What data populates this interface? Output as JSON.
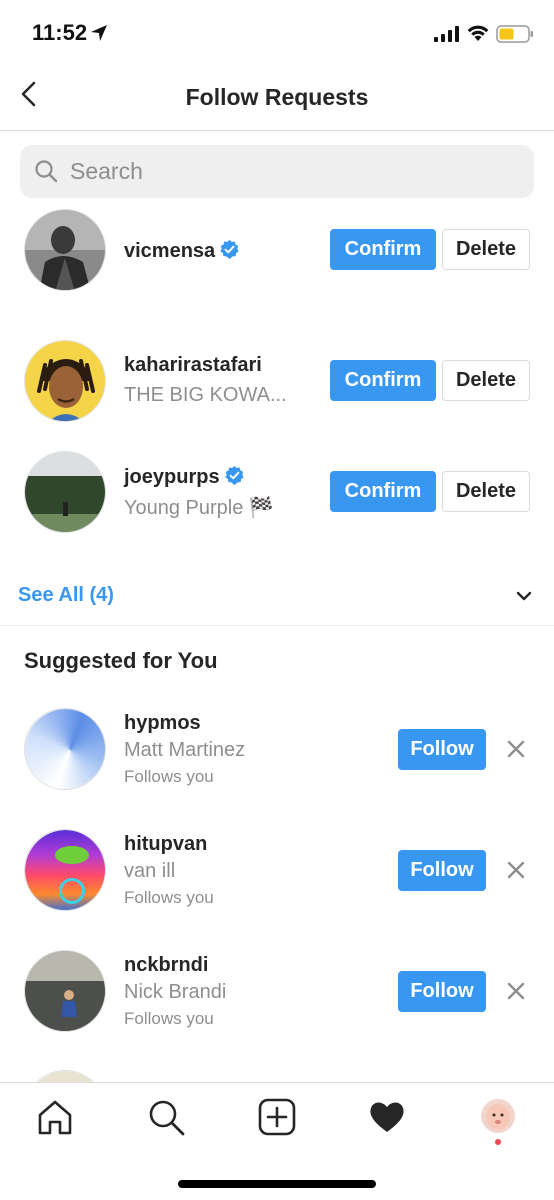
{
  "status_bar": {
    "time": "11:52"
  },
  "header": {
    "title": "Follow Requests"
  },
  "search": {
    "placeholder": "Search"
  },
  "follow_requests": [
    {
      "username": "vicmensa",
      "verified": true,
      "subtitle": "",
      "confirm_label": "Confirm",
      "delete_label": "Delete"
    },
    {
      "username": "kaharirastafari",
      "verified": false,
      "subtitle": "THE BIG KOWA...",
      "confirm_label": "Confirm",
      "delete_label": "Delete"
    },
    {
      "username": "joeypurps",
      "verified": true,
      "subtitle": "Young Purple 🏁",
      "confirm_label": "Confirm",
      "delete_label": "Delete"
    }
  ],
  "see_all": {
    "label": "See All (4)"
  },
  "suggested": {
    "title": "Suggested for You",
    "items": [
      {
        "username": "hypmos",
        "name": "Matt Martinez",
        "context": "Follows you",
        "follow_label": "Follow"
      },
      {
        "username": "hitupvan",
        "name": "van ill",
        "context": "Follows you",
        "follow_label": "Follow"
      },
      {
        "username": "nckbrndi",
        "name": "Nick Brandi",
        "context": "Follows you",
        "follow_label": "Follow"
      }
    ]
  },
  "tabbar": {
    "items": [
      "home-icon",
      "search-icon",
      "add-icon",
      "heart-icon",
      "profile-avatar"
    ]
  },
  "colors": {
    "accent": "#3897f0",
    "text": "#262626",
    "secondary": "#8e8e8e",
    "border": "#dbdbdb",
    "badge": "#ed4956"
  }
}
